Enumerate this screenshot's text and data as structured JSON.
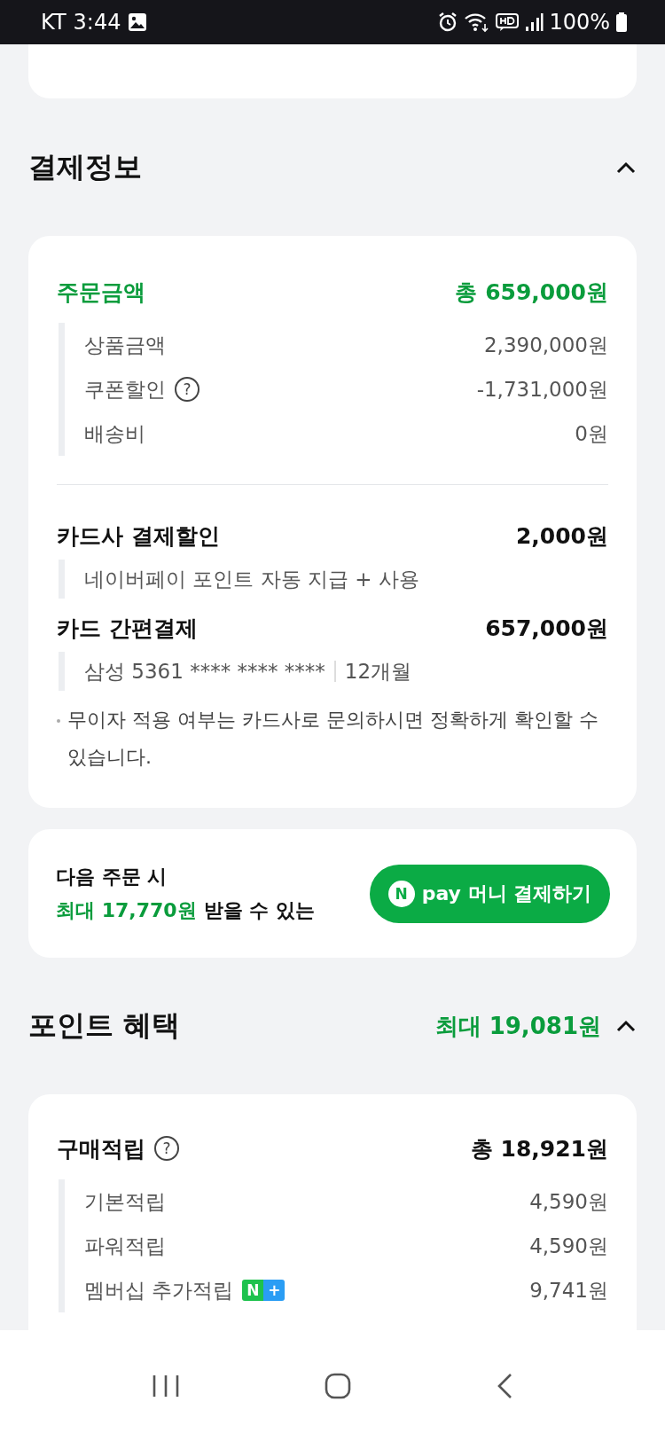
{
  "status_bar": {
    "carrier": "KT",
    "time": "3:44",
    "battery": "100%"
  },
  "payment_section": {
    "title": "결제정보",
    "expanded": true
  },
  "order": {
    "label": "주문금액",
    "total": "총 659,000원",
    "items": [
      {
        "label": "상품금액",
        "value": "2,390,000원"
      },
      {
        "label": "쿠폰할인",
        "help": "?",
        "value": "-1,731,000원"
      },
      {
        "label": "배송비",
        "value": "0원"
      }
    ]
  },
  "card_discount": {
    "label": "카드사 결제할인",
    "value": "2,000원",
    "note": "네이버페이 포인트 자동 지급 + 사용"
  },
  "card_payment": {
    "label": "카드 간편결제",
    "value": "657,000원",
    "card": "삼성 5361 **** **** ****",
    "installment": "12개월"
  },
  "notice": "무이자 적용 여부는 카드사로 문의하시면 정확하게 확인할 수 있습니다.",
  "promo": {
    "line1": "다음 주문 시",
    "highlight": "최대 17,770원",
    "rest": "받을 수 있는",
    "button_logo": "N",
    "button_label": "pay 머니 결제하기"
  },
  "points_section": {
    "title": "포인트 혜택",
    "summary": "최대 19,081원",
    "expanded": true
  },
  "purchase": {
    "label": "구매적립",
    "help": "?",
    "total": "총 18,921원",
    "items": [
      {
        "label": "기본적립",
        "value": "4,590원"
      },
      {
        "label": "파워적립",
        "value": "4,590원"
      },
      {
        "label": "멤버십 추가적립",
        "badge": [
          "N",
          "+"
        ],
        "value": "9,741원"
      }
    ]
  }
}
